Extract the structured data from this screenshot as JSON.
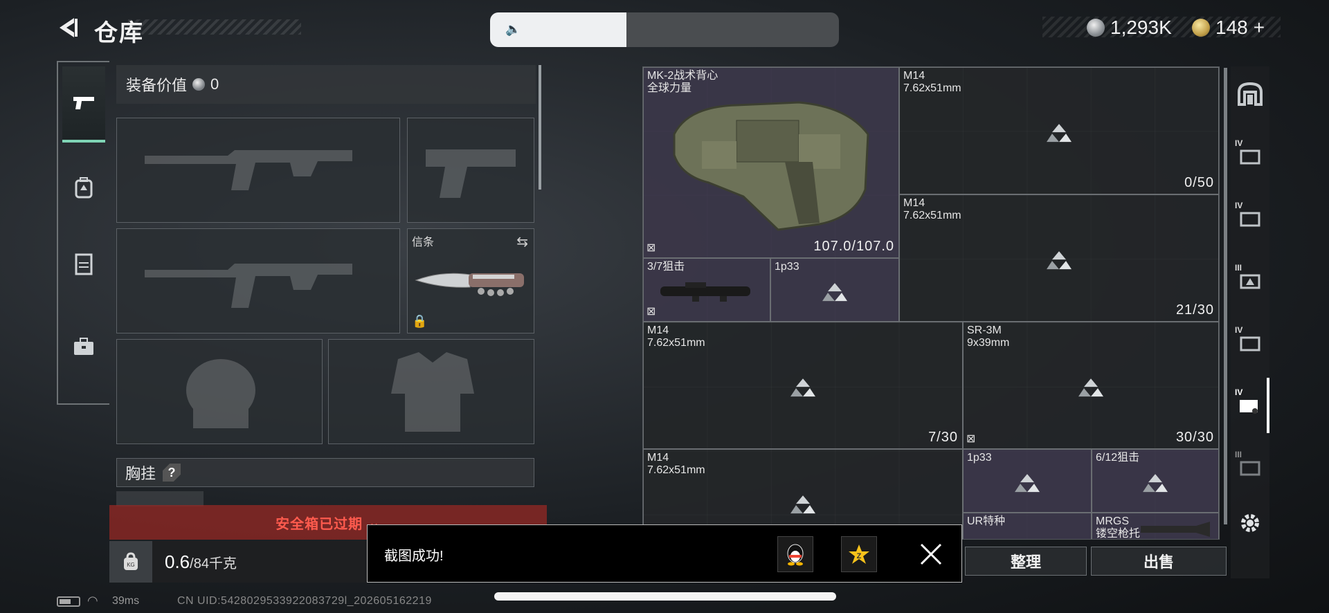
{
  "header": {
    "title": "仓库",
    "volume_level_percent": 39
  },
  "currency": {
    "silver_amount": "1,293K",
    "gold_amount": "148",
    "gold_add": "+"
  },
  "equipment": {
    "value_label": "装备价值",
    "value_amount": "0",
    "melee_label": "信条",
    "vest_label": "胸挂",
    "vest_help": "?"
  },
  "safe_box": {
    "expired_text": "安全箱已过期"
  },
  "weight": {
    "icon_text": "KG",
    "current": "0.6",
    "capacity": "/84千克"
  },
  "stash": {
    "items": [
      {
        "name": "MK-2战术背心\n全球力量",
        "count": "107.0/107.0"
      },
      {
        "name": "M14\n7.62x51mm",
        "count": "0/50"
      },
      {
        "name": "M14\n7.62x51mm",
        "count": "21/30"
      },
      {
        "name": "3/7狙击",
        "count": ""
      },
      {
        "name": "1p33",
        "count": ""
      },
      {
        "name": "M14\n7.62x51mm",
        "count": "7/30"
      },
      {
        "name": "SR-3M\n9x39mm",
        "count": "30/30"
      },
      {
        "name": "M14\n7.62x51mm",
        "count": ""
      },
      {
        "name": "1p33",
        "count": ""
      },
      {
        "name": "6/12狙击",
        "count": ""
      },
      {
        "name": "UR特种",
        "count": ""
      },
      {
        "name": "MRGS\n镂空枪托",
        "count": ""
      }
    ]
  },
  "buttons": {
    "sort": "整理",
    "sell": "出售"
  },
  "toast": {
    "message": "截图成功!"
  },
  "status": {
    "ping": "39ms",
    "uid": "CN UID:5428029533922083729l_202605162219"
  },
  "colors": {
    "active_tab_accent": "#7fd4b5",
    "safe_box_warning": "#ff5b4e",
    "item_highlight": "#3e3a4e"
  }
}
